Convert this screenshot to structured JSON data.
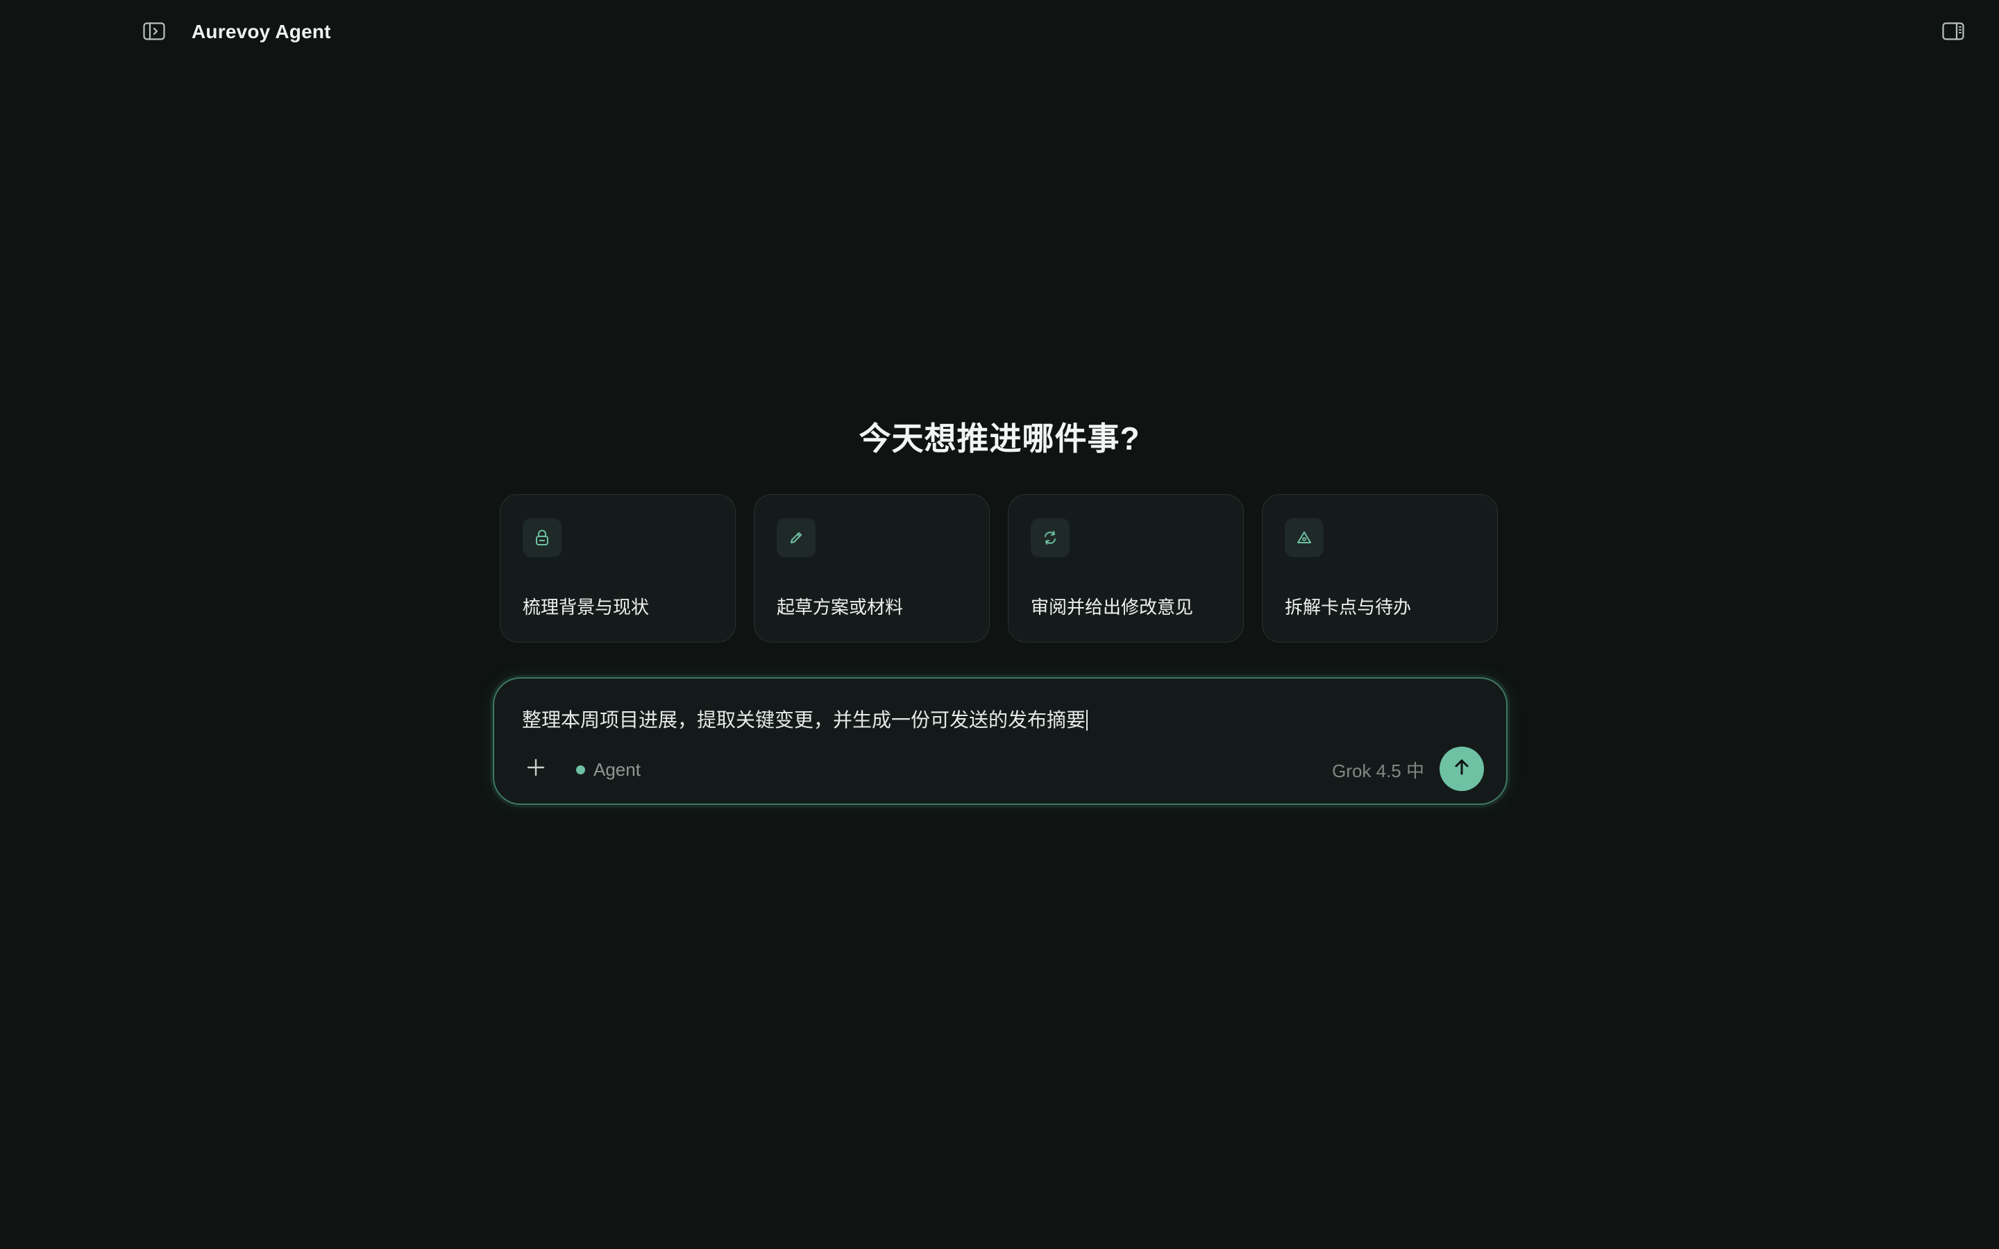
{
  "app": {
    "title": "Aurevoy Agent"
  },
  "headline": "今天想推进哪件事?",
  "cards": [
    {
      "icon": "lock-icon",
      "label": "梳理背景与现状"
    },
    {
      "icon": "pencil-icon",
      "label": "起草方案或材料"
    },
    {
      "icon": "refresh-icon",
      "label": "审阅并给出修改意见"
    },
    {
      "icon": "triangle-alert-icon",
      "label": "拆解卡点与待办"
    }
  ],
  "composer": {
    "value": "整理本周项目进展，提取关键变更，并生成一份可发送的发布摘要",
    "mode_label": "Agent",
    "model_label": "Grok 4.5 中"
  },
  "colors": {
    "background": "#0f1413",
    "card_background": "#151b1a",
    "accent": "#6fc1a4",
    "composer_border": "#3f7a66"
  }
}
